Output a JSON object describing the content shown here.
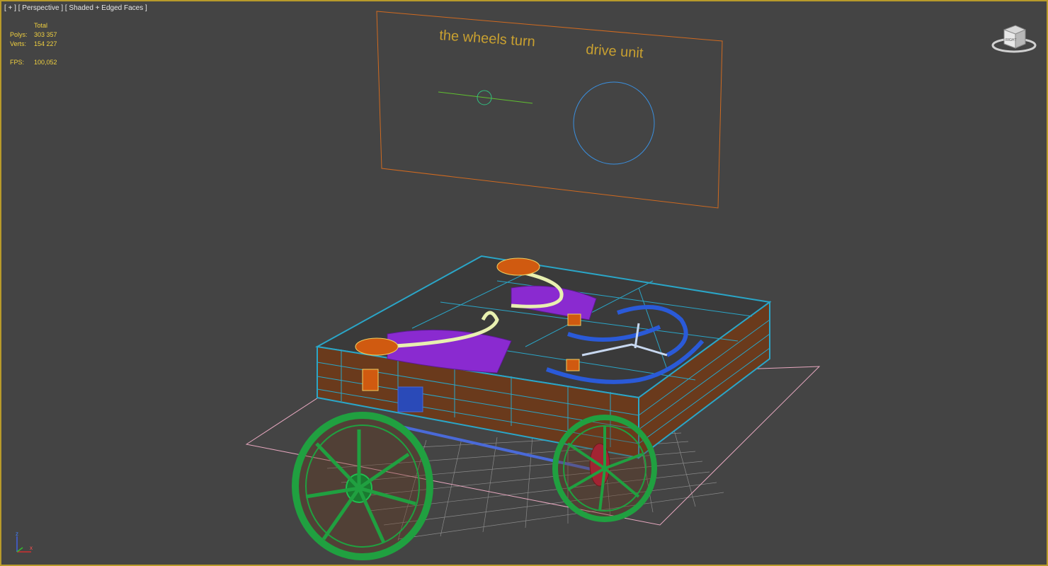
{
  "viewport": {
    "menu": {
      "plus": "[ + ]",
      "view": "[ Perspective ]",
      "shading": "[ Shaded + Edged Faces ]"
    },
    "stats": {
      "total_header": "Total",
      "polys_label": "Polys:",
      "polys_value": "303 357",
      "verts_label": "Verts:",
      "verts_value": "154 227",
      "fps_label": "FPS:",
      "fps_value": "100,052"
    },
    "viewcube_label": "RIGHT",
    "axis": {
      "z": "z",
      "x": "x"
    }
  },
  "scene": {
    "panel_labels": {
      "left": "the wheels turn",
      "right": "drive unit"
    },
    "colors": {
      "background": "#444444",
      "border_active": "#b89a2a",
      "text_label": "#c8a030",
      "frame_wire": "#2aa6c8",
      "frame_wood": "#8a4a24",
      "wheel_wire": "#20a040",
      "purple_part": "#8a2ad0",
      "blue_part": "#2a5ad8",
      "yellow_part": "#e8f0b0",
      "orange_part": "#d05a10",
      "grid_pink": "#e8a8c0"
    }
  }
}
